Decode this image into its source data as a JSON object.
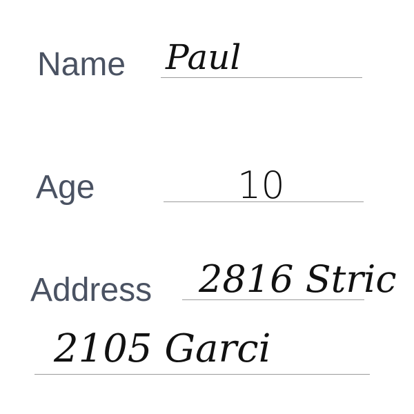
{
  "form": {
    "name": {
      "label": "Name",
      "value": "Paul"
    },
    "age": {
      "label": "Age",
      "value": "10"
    },
    "address": {
      "label": "Address",
      "line1": "2816 Stric",
      "line2": "2105 Garci"
    }
  },
  "colors": {
    "label_text": "#4a5262",
    "handwriting": "#111111",
    "rule": "#9a9a9a",
    "background": "#ffffff"
  }
}
